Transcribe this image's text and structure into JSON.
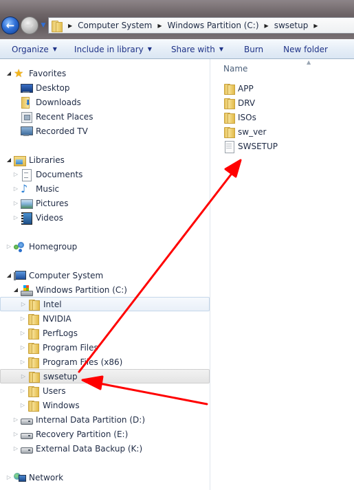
{
  "navigation": {
    "back_icon": "back-arrow-icon",
    "forward_icon": "forward-arrow-icon",
    "history_icon": "chevron-down-icon"
  },
  "address_bar": {
    "icon": "folder-icon",
    "breadcrumbs": [
      "Computer System",
      "Windows Partition (C:)",
      "swsetup"
    ]
  },
  "toolbar": {
    "organize_label": "Organize",
    "include_label": "Include in library",
    "share_label": "Share with",
    "burn_label": "Burn",
    "new_folder_label": "New folder"
  },
  "nav_pane": {
    "favorites": {
      "label": "Favorites",
      "items": [
        {
          "label": "Desktop",
          "icon": "desktop-icon"
        },
        {
          "label": "Downloads",
          "icon": "downloads-icon"
        },
        {
          "label": "Recent Places",
          "icon": "recent-places-icon"
        },
        {
          "label": "Recorded TV",
          "icon": "recorded-tv-icon"
        }
      ]
    },
    "libraries": {
      "label": "Libraries",
      "items": [
        {
          "label": "Documents",
          "icon": "documents-icon"
        },
        {
          "label": "Music",
          "icon": "music-icon"
        },
        {
          "label": "Pictures",
          "icon": "pictures-icon"
        },
        {
          "label": "Videos",
          "icon": "videos-icon"
        }
      ]
    },
    "homegroup": {
      "label": "Homegroup"
    },
    "computer": {
      "label": "Computer System",
      "drive_c": {
        "label": "Windows Partition (C:)",
        "folders": [
          "Intel",
          "NVIDIA",
          "PerfLogs",
          "Program Files",
          "Program Files (x86)",
          "swsetup",
          "Users",
          "Windows"
        ],
        "hover_folder": "Intel",
        "selected_folder": "swsetup"
      },
      "other_drives": [
        "Internal Data Partition (D:)",
        "Recovery Partition (E:)",
        "External Data Backup (K:)"
      ]
    },
    "network": {
      "label": "Network"
    }
  },
  "content": {
    "column_name": "Name",
    "items": [
      {
        "label": "APP",
        "type": "folder"
      },
      {
        "label": "DRV",
        "type": "folder"
      },
      {
        "label": "ISOs",
        "type": "folder"
      },
      {
        "label": "sw_ver",
        "type": "folder"
      },
      {
        "label": "SWSETUP",
        "type": "file"
      }
    ]
  },
  "annotations": {
    "arrow_color": "#ff0000"
  }
}
